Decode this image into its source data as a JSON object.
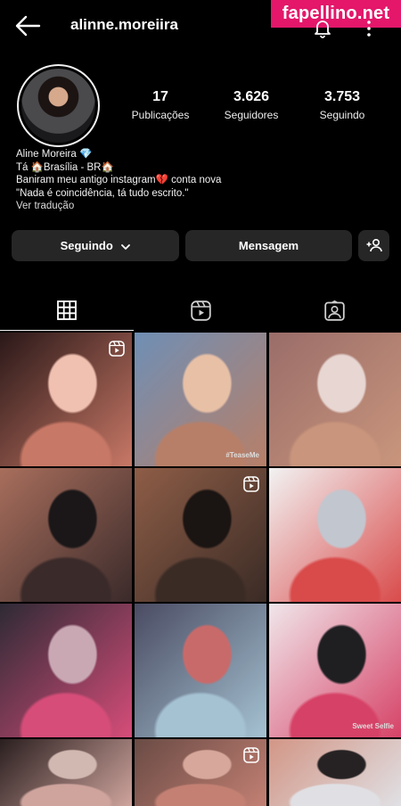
{
  "watermark": "fapellino.net",
  "header": {
    "username": "alinne.moreiira",
    "icons": [
      "back-arrow-icon",
      "bell-icon",
      "more-icon"
    ]
  },
  "profile": {
    "stats": [
      {
        "value": "17",
        "label": "Publicações"
      },
      {
        "value": "3.626",
        "label": "Seguidores"
      },
      {
        "value": "3.753",
        "label": "Seguindo"
      }
    ],
    "bio": [
      "Aline Moreira 💎",
      "Tá 🏠Brasília - BR🏠",
      "Baniram meu antigo instagram💔 conta nova",
      "\"Nada é coincidência, tá tudo escrito.\""
    ],
    "see_translation": "Ver tradução"
  },
  "actions": {
    "following_label": "Seguindo",
    "message_label": "Mensagem"
  },
  "tabs": [
    "grid-icon",
    "reels-icon",
    "tagged-icon"
  ],
  "posts": [
    {
      "kind": "reel",
      "colors": [
        "#c87866",
        "#2a1818",
        "#f0c0b0"
      ]
    },
    {
      "kind": "photo",
      "colors": [
        "#b77f68",
        "#6f8fb5",
        "#e7c0a6"
      ],
      "caption": "#TeaseMe"
    },
    {
      "kind": "photo",
      "colors": [
        "#c9957c",
        "#9a6d69",
        "#e7d6d2"
      ]
    },
    {
      "kind": "photo",
      "colors": [
        "#3a2a2a",
        "#a86e5c",
        "#1b1718"
      ]
    },
    {
      "kind": "reel",
      "colors": [
        "#3a2b25",
        "#8e5d47",
        "#1a1412"
      ]
    },
    {
      "kind": "photo",
      "colors": [
        "#d94b4b",
        "#f2f2f2",
        "#c2c6cf"
      ]
    },
    {
      "kind": "photo",
      "colors": [
        "#d64d79",
        "#2e2a35",
        "#c9a8b4"
      ]
    },
    {
      "kind": "photo",
      "colors": [
        "#a5c2d2",
        "#4a4b62",
        "#c96a6a"
      ]
    },
    {
      "kind": "photo",
      "colors": [
        "#d64267",
        "#f0e6ea",
        "#1f1f22"
      ],
      "caption": "Sweet Selfie"
    },
    {
      "kind": "photo",
      "colors": [
        "#cfa49d",
        "#2a1f1f",
        "#d1b8b0"
      ]
    },
    {
      "kind": "reel",
      "colors": [
        "#c38073",
        "#6a4b45",
        "#d6a79a"
      ]
    },
    {
      "kind": "photo",
      "colors": [
        "#e0e0e4",
        "#d29686",
        "#262224"
      ]
    }
  ]
}
